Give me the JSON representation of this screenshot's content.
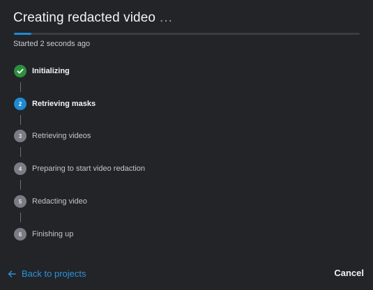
{
  "dialog": {
    "title": "Creating redacted video",
    "title_suffix": "...",
    "progress_percent": 5,
    "started_text": "Started 2 seconds ago"
  },
  "steps": [
    {
      "number": "1",
      "label": "Initializing",
      "status": "done",
      "icon": "check-icon"
    },
    {
      "number": "2",
      "label": "Retrieving masks",
      "status": "active"
    },
    {
      "number": "3",
      "label": "Retrieving videos",
      "status": "pending"
    },
    {
      "number": "4",
      "label": "Preparing to start video redaction",
      "status": "pending"
    },
    {
      "number": "5",
      "label": "Redacting video",
      "status": "pending"
    },
    {
      "number": "6",
      "label": "Finishing up",
      "status": "pending"
    }
  ],
  "footer": {
    "back_label": "Back to projects",
    "back_icon": "arrow-left-icon",
    "cancel_label": "Cancel"
  },
  "colors": {
    "background": "#222428",
    "accent": "#1f8ad4",
    "success": "#2e8f3e",
    "pending": "#7a7d83"
  }
}
